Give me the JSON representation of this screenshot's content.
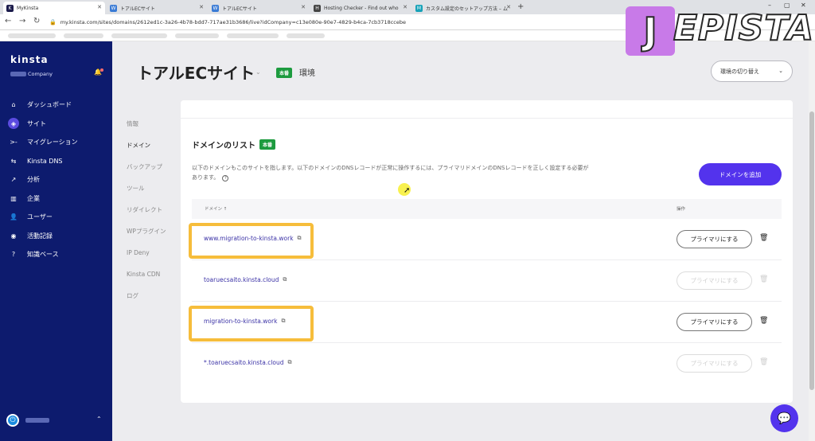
{
  "browser": {
    "tabs": [
      {
        "title": "MyKinsta",
        "favicon": "K",
        "color": "#1b1b4b"
      },
      {
        "title": "トアルECサイト",
        "favicon": "W",
        "color": "#3a7bd5"
      },
      {
        "title": "トアルECサイト",
        "favicon": "W",
        "color": "#3a7bd5"
      },
      {
        "title": "Hosting Checker - Find out who",
        "favicon": "H",
        "color": "#444444"
      },
      {
        "title": "カスタム設定のセットアップ方法 – ム",
        "favicon": "M",
        "color": "#17a2b8"
      }
    ],
    "url": "my.kinsta.com/sites/domains/2612ed1c-3a26-4b78-bdd7-717ae31b3686/live?idCompany=c13e080e-90e7-4829-b4ca-7cb3718ccebe"
  },
  "watermark": {
    "letter": "J",
    "rest": "EPISTA"
  },
  "sidebar": {
    "brand": "kinsta",
    "company": "Company",
    "items": [
      {
        "label": "ダッシュボード",
        "icon": "home-icon",
        "glyph": "⌂"
      },
      {
        "label": "サイト",
        "icon": "sites-icon",
        "glyph": "◈"
      },
      {
        "label": "マイグレーション",
        "icon": "migration-icon",
        "glyph": ">-"
      },
      {
        "label": "Kinsta DNS",
        "icon": "dns-icon",
        "glyph": "⇆"
      },
      {
        "label": "分析",
        "icon": "analytics-icon",
        "glyph": "↗"
      },
      {
        "label": "企業",
        "icon": "company-icon",
        "glyph": "▥"
      },
      {
        "label": "ユーザー",
        "icon": "user-add-icon",
        "glyph": "👤"
      },
      {
        "label": "活動記録",
        "icon": "eye-icon",
        "glyph": "◉"
      },
      {
        "label": "知識ベース",
        "icon": "help-circle-icon",
        "glyph": "?"
      }
    ]
  },
  "header": {
    "title": "トアルECサイト",
    "env_badge": "本番",
    "env_label": "環境",
    "env_switch": "環境の切り替え"
  },
  "subnav": [
    {
      "label": "情報"
    },
    {
      "label": "ドメイン"
    },
    {
      "label": "バックアップ"
    },
    {
      "label": "ツール"
    },
    {
      "label": "リダイレクト"
    },
    {
      "label": "WPプラグイン"
    },
    {
      "label": "IP Deny"
    },
    {
      "label": "Kinsta CDN"
    },
    {
      "label": "ログ"
    }
  ],
  "domains": {
    "title": "ドメインのリスト",
    "badge": "本番",
    "description": "以下のドメインもこのサイトを指します。以下のドメインのDNSレコードが正常に操作するには、プライマリドメインのDNSレコードを正しく設定する必要があります。",
    "add_button": "ドメインを追加",
    "col_domain": "ドメイン ↑",
    "col_action": "操作",
    "rows": [
      {
        "domain": "www.migration-to-kinsta.work",
        "action": "プライマリにする",
        "enabled": true
      },
      {
        "domain": "toaruecsaito.kinsta.cloud",
        "action": "プライマリにする",
        "enabled": false
      },
      {
        "domain": "migration-to-kinsta.work",
        "action": "プライマリにする",
        "enabled": true
      },
      {
        "domain": "*.toaruecsaito.kinsta.cloud",
        "action": "プライマリにする",
        "enabled": false
      }
    ]
  },
  "colors": {
    "sidebar": "#0d1b6e",
    "accent": "#5333ed",
    "badge_green": "#1d9b3f",
    "highlight": "#f6bd3b"
  }
}
